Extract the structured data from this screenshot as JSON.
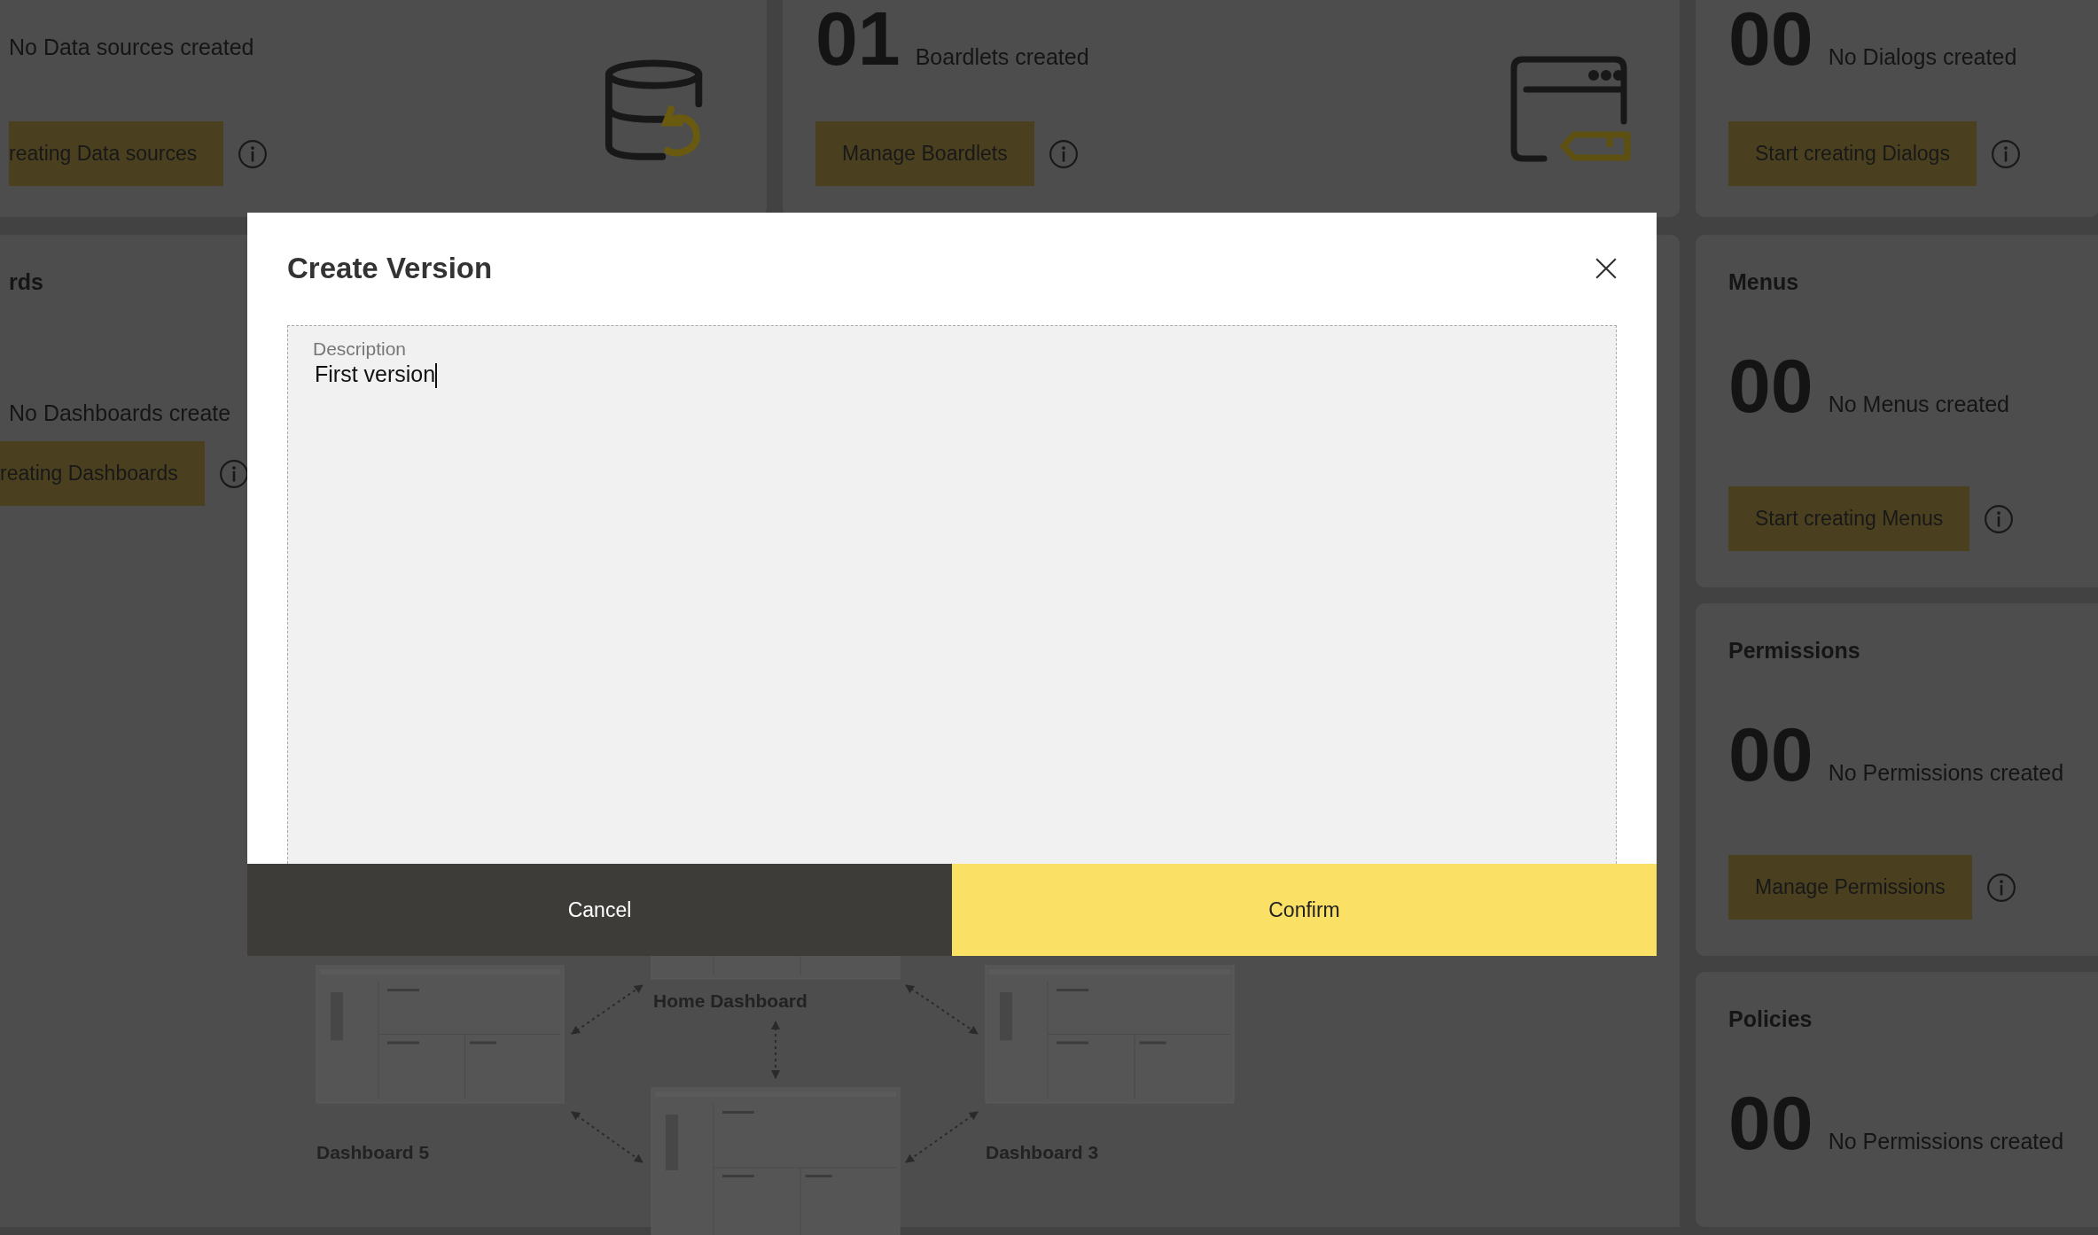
{
  "data_sources_card": {
    "summary": "No Data sources created",
    "button": "reating Data sources"
  },
  "boardlets_card": {
    "count": "01",
    "summary": "Boardlets created",
    "button": "Manage Boardlets"
  },
  "dialogs_card": {
    "count": "00",
    "summary": "No Dialogs created",
    "button": "Start creating Dialogs"
  },
  "dashboards_card": {
    "title": "rds",
    "summary": "No Dashboards create",
    "button": "reating Dashboards",
    "diagram": {
      "nodes": [
        {
          "label": "Home Dashboard"
        },
        {
          "label": "Dashboard 5"
        },
        {
          "label": "Dashboard 3"
        }
      ]
    }
  },
  "side_cards": [
    {
      "title": "Menus",
      "count": "00",
      "summary": "No Menus created",
      "button": "Start creating Menus"
    },
    {
      "title": "Permissions",
      "count": "00",
      "summary": "No Permissions created",
      "button": "Manage Permissions"
    },
    {
      "title": "Policies",
      "count": "00",
      "summary": "No Permissions created"
    }
  ],
  "dialog": {
    "title": "Create Version",
    "field": {
      "label": "Description",
      "value": "First version"
    },
    "buttons": [
      {
        "label": "Cancel",
        "kind": "secondary"
      },
      {
        "label": "Confirm",
        "kind": "primary"
      }
    ]
  }
}
